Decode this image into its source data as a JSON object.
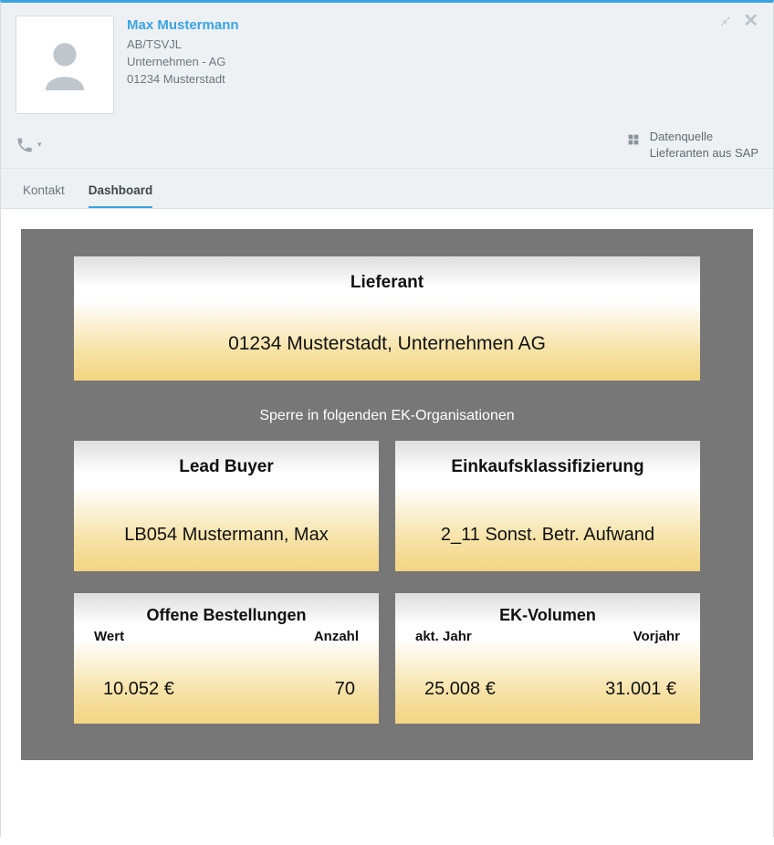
{
  "header": {
    "name": "Max Mustermann",
    "line1": "AB/TSVJL",
    "line2": "Unternehmen - AG",
    "line3": "01234 Musterstadt"
  },
  "datasource": {
    "label": "Datenquelle",
    "value": "Lieferanten aus SAP"
  },
  "tabs": {
    "kontakt": "Kontakt",
    "dashboard": "Dashboard"
  },
  "dashboard": {
    "lieferant": {
      "title": "Lieferant",
      "value": "01234 Musterstadt, Unternehmen AG"
    },
    "sperre": "Sperre in folgenden EK-Organisationen",
    "leadBuyer": {
      "title": "Lead Buyer",
      "value": "LB054  Mustermann, Max"
    },
    "einkauf": {
      "title": "Einkaufsklassifizierung",
      "value": "2_11 Sonst. Betr. Aufwand"
    },
    "offene": {
      "title": "Offene Bestellungen",
      "col1Label": "Wert",
      "col1Value": "10.052 €",
      "col2Label": "Anzahl",
      "col2Value": "70"
    },
    "volumen": {
      "title": "EK-Volumen",
      "col1Label": "akt. Jahr",
      "col1Value": "25.008 €",
      "col2Label": "Vorjahr",
      "col2Value": "31.001 €"
    }
  }
}
